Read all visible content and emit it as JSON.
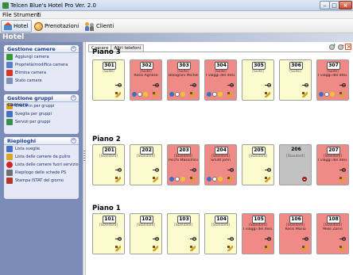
{
  "window": {
    "title": "Telcen Blue's Hotel Pro Ver. 2.0",
    "min_label": "–",
    "max_label": "□",
    "close_label": "×"
  },
  "menu": [
    "File",
    "Strumenti",
    "?"
  ],
  "toolbar": [
    {
      "label": "Hotel",
      "icon": "home-icon",
      "active": true
    },
    {
      "label": "Prenotazioni",
      "icon": "booking-icon",
      "active": false
    },
    {
      "label": "Clienti",
      "icon": "clients-icon",
      "active": false
    }
  ],
  "header_title": "Hotel",
  "sidebar": {
    "panels": [
      {
        "title": "Gestione camere",
        "collapse": "«",
        "items": [
          {
            "label": "Aggiungi camera",
            "icon": "add-icon",
            "color": "#3a9a3a"
          },
          {
            "label": "Proprietà/modifica camera",
            "icon": "edit-icon",
            "color": "#5a7fc4"
          },
          {
            "label": "Elimina camera",
            "icon": "delete-icon",
            "color": "#d03a2a"
          },
          {
            "label": "Stato camere",
            "icon": "status-icon",
            "color": "#8090b0"
          }
        ]
      },
      {
        "title": "Gestione gruppi camere",
        "collapse": "«",
        "items": [
          {
            "label": "Check-in per gruppi",
            "icon": "checkin-icon",
            "color": "#d8a030"
          },
          {
            "label": "Sveglia per gruppi",
            "icon": "alarm-icon",
            "color": "#4a6fc0"
          },
          {
            "label": "Servizi per gruppi",
            "icon": "services-icon",
            "color": "#3a8f4a"
          }
        ]
      },
      {
        "title": "Riepiloghi",
        "collapse": "«",
        "items": [
          {
            "label": "Lista sveglie",
            "icon": "alarm-list-icon",
            "color": "#4a6fc0"
          },
          {
            "label": "Lista delle camere da pulire",
            "icon": "broom-icon",
            "color": "#d7a52c"
          },
          {
            "label": "Lista delle camere fuori servizio",
            "icon": "no-entry-icon",
            "color": "#d0232a"
          },
          {
            "label": "Riepilogo delle schede PS",
            "icon": "people-icon",
            "color": "#707070"
          },
          {
            "label": "Stampa ISTAT del giorno",
            "icon": "print-icon",
            "color": "#b03a2a"
          }
        ]
      }
    ]
  },
  "tabs": [
    "Camere",
    "Altri telefoni"
  ],
  "floors": [
    {
      "title": "Piano 3",
      "rooms": [
        {
          "number": "301",
          "type": "[Suite]",
          "guest": "",
          "status": "free",
          "icons": [
            "key",
            "broom"
          ]
        },
        {
          "number": "302",
          "type": "[Suite]",
          "guest": "Rossi Agnese",
          "status": "occ",
          "icons": [
            "key",
            "state"
          ]
        },
        {
          "number": "303",
          "type": "[Suite]",
          "guest": "Bolognini Michele",
          "status": "occ",
          "icons": [
            "key",
            "state"
          ]
        },
        {
          "number": "304",
          "type": "[Suite]",
          "guest": "I viaggi del desi...",
          "status": "occ",
          "icons": [
            "key",
            "state"
          ]
        },
        {
          "number": "305",
          "type": "[Suite]",
          "guest": "",
          "status": "free",
          "icons": [
            "key",
            "broom"
          ]
        },
        {
          "number": "306",
          "type": "[Suite]",
          "guest": "",
          "status": "free",
          "icons": [
            "key",
            "broom"
          ]
        },
        {
          "number": "307",
          "type": "[Suite]",
          "guest": "I viaggi del desi...",
          "status": "occ",
          "icons": [
            "key",
            "state"
          ]
        }
      ]
    },
    {
      "title": "Piano 2",
      "rooms": [
        {
          "number": "201",
          "type": "[Standard]",
          "guest": "",
          "status": "free",
          "icons": [
            "key",
            "broom"
          ]
        },
        {
          "number": "202",
          "type": "[Standard]",
          "guest": "",
          "status": "free",
          "icons": [
            "key",
            "broom"
          ]
        },
        {
          "number": "203",
          "type": "[Standard]",
          "guest": "Picchi Massimilia...",
          "status": "occ",
          "icons": [
            "key",
            "state"
          ]
        },
        {
          "number": "204",
          "type": "[Standard]",
          "guest": "Smith John",
          "status": "occ",
          "icons": [
            "key",
            "state"
          ]
        },
        {
          "number": "205",
          "type": "[Standard]",
          "guest": "",
          "status": "free",
          "icons": [
            "key",
            "broom"
          ]
        },
        {
          "number": "206",
          "type": "[Standard]",
          "guest": "",
          "status": "oos",
          "icons": [
            "noentry"
          ]
        },
        {
          "number": "207",
          "type": "[Standard]",
          "guest": "I viaggi del desi...",
          "status": "occ",
          "icons": [
            "key",
            "broom"
          ]
        }
      ]
    },
    {
      "title": "Piano 1",
      "rooms": [
        {
          "number": "101",
          "type": "[Standard]",
          "guest": "",
          "status": "free",
          "icons": [
            "key",
            "broom"
          ]
        },
        {
          "number": "102",
          "type": "[Standard]",
          "guest": "",
          "status": "free",
          "icons": [
            "key",
            "broom"
          ]
        },
        {
          "number": "103",
          "type": "[Standard]",
          "guest": "",
          "status": "free",
          "icons": [
            "key",
            "broom"
          ]
        },
        {
          "number": "104",
          "type": "[Standard]",
          "guest": "",
          "status": "free",
          "icons": [
            "key",
            "broom"
          ]
        },
        {
          "number": "105",
          "type": "[Standard]",
          "guest": "I viaggi del desi...",
          "status": "occ",
          "icons": [
            "key",
            "broom"
          ]
        },
        {
          "number": "106",
          "type": "[Standard]",
          "guest": "Rossi Mario",
          "status": "occ",
          "icons": [
            "key",
            "broom"
          ]
        },
        {
          "number": "108",
          "type": "[Standard]",
          "guest": "Mike Zorro",
          "status": "occ",
          "icons": [
            "key",
            "broom"
          ]
        }
      ]
    }
  ]
}
